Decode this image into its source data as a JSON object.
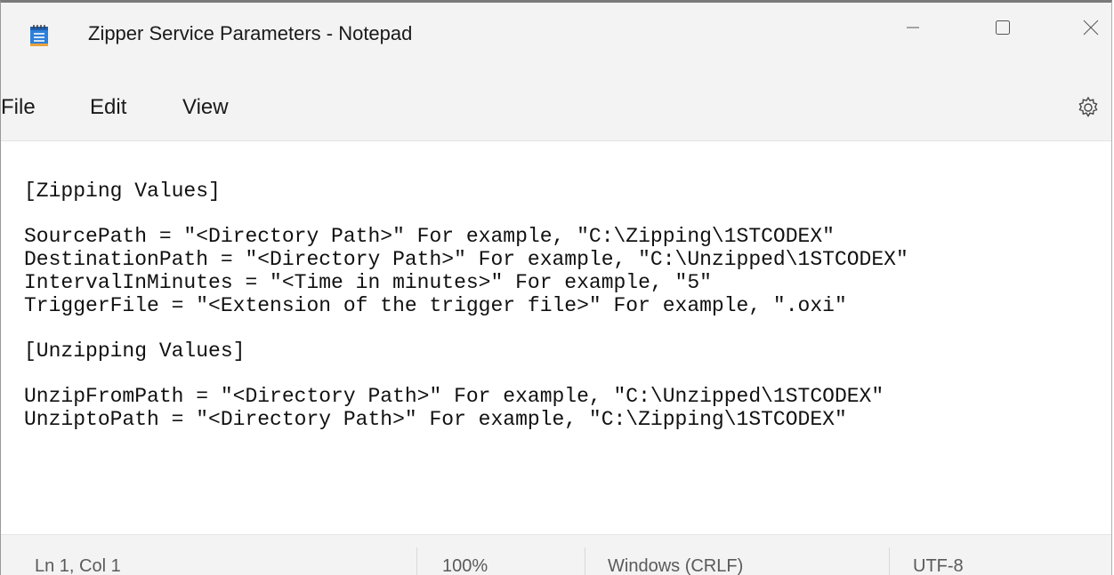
{
  "window": {
    "title": "Zipper Service Parameters - Notepad"
  },
  "menu": {
    "file": "File",
    "edit": "Edit",
    "view": "View"
  },
  "icons": {
    "app": "notepad-icon",
    "minimize": "minimize-icon",
    "maximize": "maximize-icon",
    "close": "close-icon",
    "settings": "gear-icon"
  },
  "editor": {
    "lines": [
      "[Zipping Values]",
      "",
      "SourcePath = \"<Directory Path>\" For example, \"C:\\Zipping\\1STCODEX\"",
      "DestinationPath = \"<Directory Path>\" For example, \"C:\\Unzipped\\1STCODEX\"",
      "IntervalInMinutes = \"<Time in minutes>\" For example, \"5\"",
      "TriggerFile = \"<Extension of the trigger file>\" For example, \".oxi\"",
      "",
      "[Unzipping Values]",
      "",
      "UnzipFromPath = \"<Directory Path>\" For example, \"C:\\Unzipped\\1STCODEX\"",
      "UnziptoPath = \"<Directory Path>\" For example, \"C:\\Zipping\\1STCODEX\""
    ]
  },
  "status": {
    "position": "Ln 1, Col 1",
    "zoom": "100%",
    "line_endings": "Windows (CRLF)",
    "encoding": "UTF-8"
  }
}
